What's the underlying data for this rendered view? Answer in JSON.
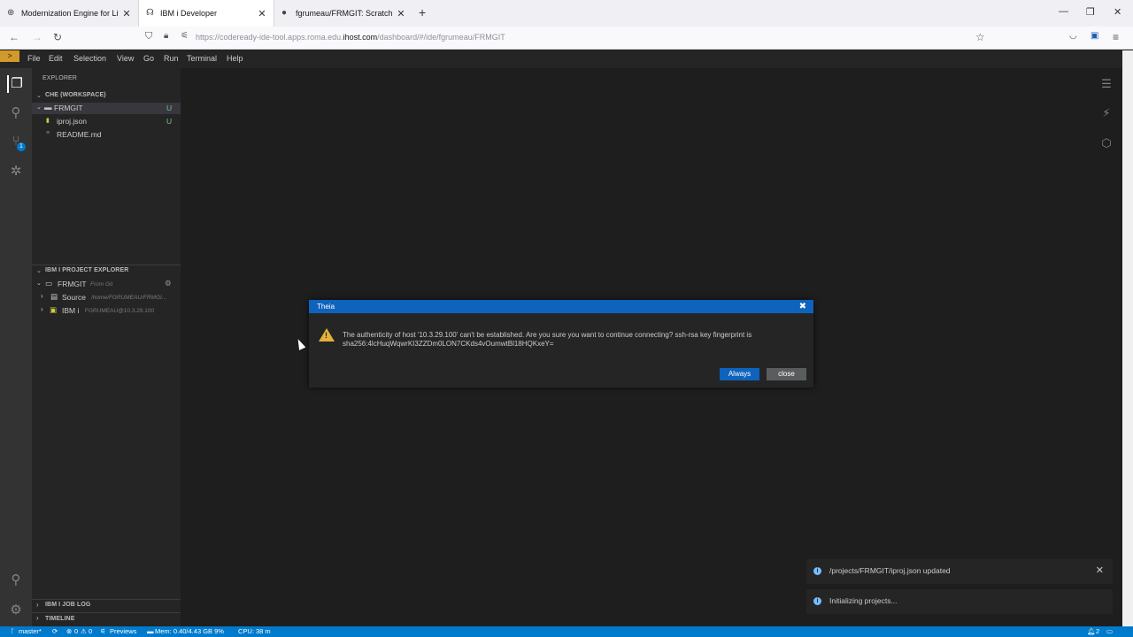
{
  "browser": {
    "tabs": [
      {
        "label": "Modernization Engine for Lifecy",
        "icon": "globe-icon"
      },
      {
        "label": "IBM i Developer",
        "icon": "headset-icon"
      },
      {
        "label": "fgrumeau/FRMGIT: Scratch fro",
        "icon": "github-icon"
      }
    ],
    "new_tab": "+",
    "url_prefix": "https://codeready-ide-tool.apps.roma.edu.",
    "url_host": "ihost.com",
    "url_suffix": "/dashboard/#/ide/fgrumeau/FRMGIT"
  },
  "ide": {
    "menu": [
      "File",
      "Edit",
      "Selection",
      "View",
      "Go",
      "Run",
      "Terminal",
      "Help"
    ],
    "scm_badge": "1",
    "explorer": {
      "title": "EXPLORER",
      "workspace": "CHE (WORKSPACE)",
      "folder": "FRMGIT",
      "folder_status": "U",
      "files": [
        {
          "name": "iproj.json",
          "status": "U"
        },
        {
          "name": "README.md",
          "status": ""
        }
      ]
    },
    "project_explorer": {
      "title": "IBM I PROJECT EXPLORER",
      "project": "FRMGIT",
      "project_note": "From Git",
      "source_label": "Source",
      "source_path": "/home/FGRUMEAU/FRMGI...",
      "ibmi_label": "IBM i",
      "ibmi_host": "FGRUMEAU@10.3.29.100"
    },
    "panels": {
      "job_log": "IBM I JOB LOG",
      "timeline": "TIMELINE"
    },
    "dialog": {
      "title": "Theia",
      "message": "The authenticity of host '10.3.29.100' can't be established. Are you sure you want to continue connecting? ssh-rsa key fingerprint is sha256:4lcHuqWqwrKI3ZZDm0LON7CKds4vOumwtBl18HQKxeY=",
      "always_label": "Always",
      "close_label": "close"
    },
    "notifications": [
      {
        "text": "/projects/FRMGIT/iproj.json updated"
      },
      {
        "text": "Initializing projects..."
      }
    ],
    "status": {
      "branch": "master*",
      "errors": "0",
      "warnings": "0",
      "previews": "Previews",
      "memory": "Mem: 0.40/4.43 GB 9%",
      "cpu": "CPU: 38 m",
      "bell_count": "2"
    }
  }
}
